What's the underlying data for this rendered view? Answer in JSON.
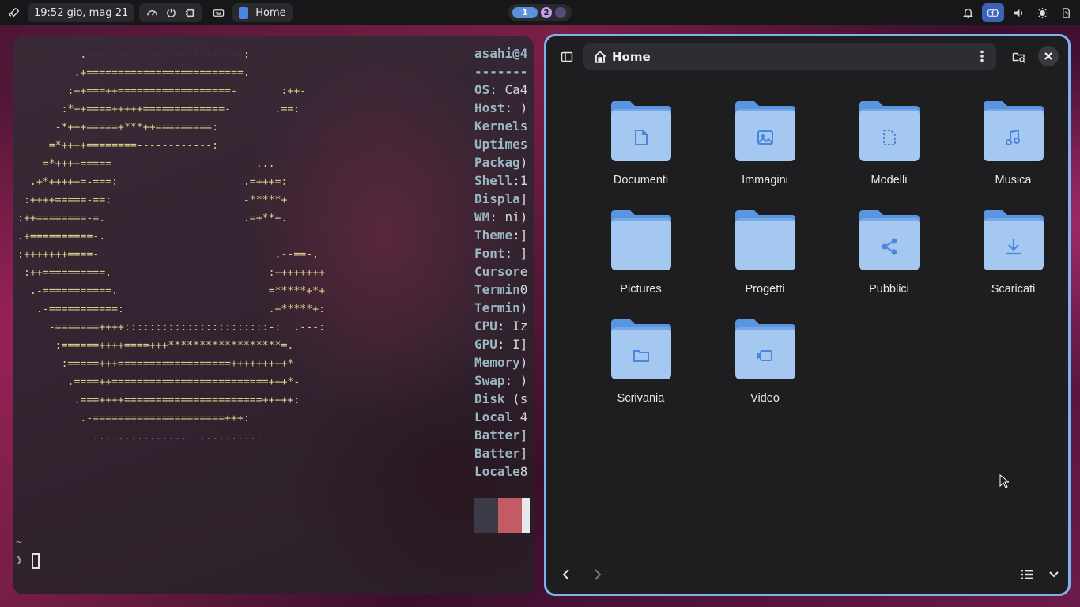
{
  "topbar": {
    "clock": "19:52 gio, mag 21",
    "active_app": "Home",
    "workspaces": [
      "1",
      "2",
      ""
    ],
    "icons_left": [
      "rocket-icon",
      "gauge-icon",
      "power-cycle-icon",
      "cpu-icon",
      "keyboard-icon"
    ],
    "icons_right": [
      "bell-icon",
      "battery-charging-icon",
      "volume-icon",
      "brightness-icon",
      "tray-app-icon"
    ]
  },
  "terminal": {
    "ascii_lines": [
      "          .-------------------------:",
      "         .+=========================.",
      "        :++===++==================-       :++-",
      "       :*++====+++++=============-       .==:",
      "      -*+++=====+***++=========:",
      "     =*++++========------------:",
      "    =*++++=====-                      ...",
      "  .+*+++++=-===:                    .=+++=:",
      " :++++=====-==:                     -*****+",
      ":++========-=.                      .=+**+.",
      ".+==========-.",
      ":+++++++====-                            .--==-.",
      " :++==========.                         :++++++++",
      "  .-===========.                        =*****+*+",
      "   .-===========:                       .+*****+:",
      "     -=======++++:::::::::::::::::::::::-:  .---:",
      "      :======++++====+++******************=.",
      "       :=====+++==================+++++++++*-",
      "        .====++=========================+++*-",
      "         .===++++======================+++++:",
      "          .-=====================+++:",
      "            ...............  .........."
    ],
    "info": [
      {
        "key": "asahi@4",
        "val": ""
      },
      {
        "key": "-------",
        "val": ""
      },
      {
        "key": "OS",
        "val": ": Ca4"
      },
      {
        "key": "Host",
        "val": ": )"
      },
      {
        "key": "Kernel",
        "val": "s"
      },
      {
        "key": "Uptime",
        "val": "s"
      },
      {
        "key": "Packag",
        "val": ")"
      },
      {
        "key": "Shell",
        "val": ":1"
      },
      {
        "key": "Displa",
        "val": "]"
      },
      {
        "key": "WM",
        "val": ": ni)"
      },
      {
        "key": "Theme",
        "val": ":]"
      },
      {
        "key": "Font",
        "val": ": ]"
      },
      {
        "key": "Cursor",
        "val": "e"
      },
      {
        "key": "Termin",
        "val": "0"
      },
      {
        "key": "Termin",
        "val": ")"
      },
      {
        "key": "CPU",
        "val": ": Iz"
      },
      {
        "key": "GPU",
        "val": ": I]"
      },
      {
        "key": "Memory",
        "val": ")"
      },
      {
        "key": "Swap",
        "val": ": )"
      },
      {
        "key": "Disk",
        "val": " (s"
      },
      {
        "key": "Local",
        "val": " 4"
      },
      {
        "key": "Batter",
        "val": "]"
      },
      {
        "key": "Batter",
        "val": "]"
      },
      {
        "key": "Locale",
        "val": "8"
      }
    ],
    "swatches": [
      "#3b3b48",
      "#c45a64",
      "#e8e8ec"
    ],
    "prompt_tilde": "~",
    "prompt_arrow": "❯"
  },
  "files": {
    "title": "Home",
    "folders": [
      {
        "label": "Documenti",
        "glyph": "document-icon"
      },
      {
        "label": "Immagini",
        "glyph": "image-icon"
      },
      {
        "label": "Modelli",
        "glyph": "template-icon"
      },
      {
        "label": "Musica",
        "glyph": "music-icon"
      },
      {
        "label": "Pictures",
        "glyph": ""
      },
      {
        "label": "Progetti",
        "glyph": ""
      },
      {
        "label": "Pubblici",
        "glyph": "share-icon"
      },
      {
        "label": "Scaricati",
        "glyph": "download-icon"
      },
      {
        "label": "Scrivania",
        "glyph": "folder-small-icon"
      },
      {
        "label": "Video",
        "glyph": "video-icon"
      }
    ],
    "accent": "#7fb2e8",
    "folder_color": "#a4c8f0",
    "folder_tab_color": "#5a95e0"
  }
}
